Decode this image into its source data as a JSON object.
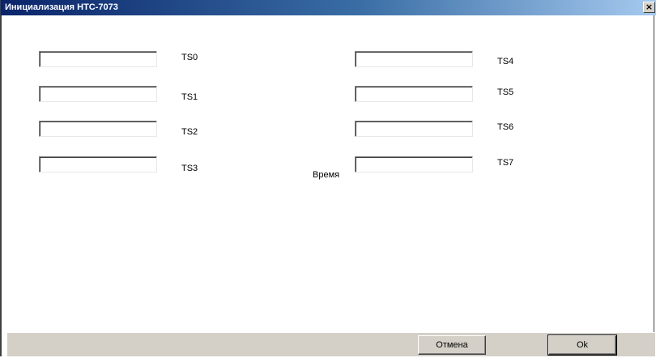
{
  "window": {
    "title": "Инициализация НТС-7073",
    "close_glyph": "×"
  },
  "fields_left": [
    {
      "label": "TS0",
      "value": ""
    },
    {
      "label": "TS1",
      "value": ""
    },
    {
      "label": "TS2",
      "value": ""
    },
    {
      "label": "TS3",
      "value": ""
    }
  ],
  "fields_right": [
    {
      "label": "TS4",
      "value": ""
    },
    {
      "label": "TS5",
      "value": ""
    },
    {
      "label": "TS6",
      "value": ""
    },
    {
      "label": "TS7",
      "value": ""
    }
  ],
  "time_label": "Время",
  "buttons": {
    "cancel": "Отмена",
    "ok": "Ok"
  }
}
